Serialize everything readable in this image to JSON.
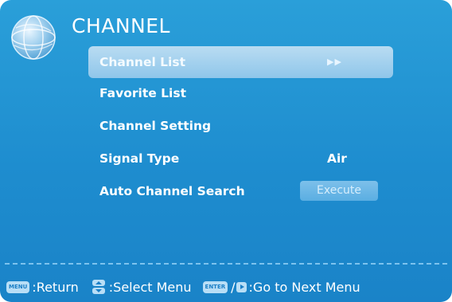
{
  "header": {
    "title": "CHANNEL",
    "icon": "globe-icon"
  },
  "menu": {
    "items": [
      {
        "label": "Channel List",
        "value": "",
        "control": "arrows",
        "arrows": "▶▶",
        "selected": true
      },
      {
        "label": "Favorite List",
        "value": "",
        "selected": false
      },
      {
        "label": "Channel Setting",
        "value": "",
        "selected": false
      },
      {
        "label": "Signal Type",
        "value": "Air",
        "selected": false
      },
      {
        "label": "Auto Channel Search",
        "value": "Execute",
        "control": "button",
        "selected": false
      }
    ]
  },
  "footer": {
    "menu_key": "MENU",
    "return_text": ":Return",
    "select_text": ":Select Menu",
    "enter_key": "ENTER",
    "slash": "/",
    "next_text": ":Go to Next Menu"
  },
  "colors": {
    "background": "#1e8dcf",
    "highlight": "#a6d3ef",
    "text": "#ffffff"
  }
}
